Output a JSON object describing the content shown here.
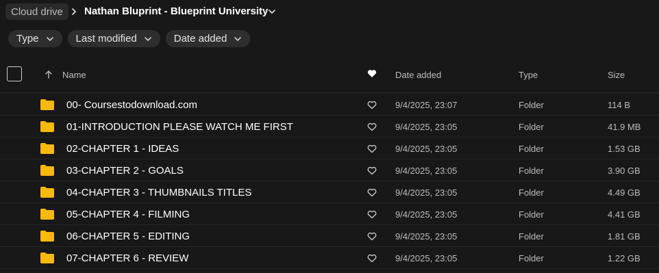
{
  "breadcrumb": {
    "root": "Cloud drive",
    "current": "Nathan Bluprint - Blueprint University"
  },
  "filters": [
    {
      "label": "Type"
    },
    {
      "label": "Last modified"
    },
    {
      "label": "Date added"
    }
  ],
  "columns": {
    "name": "Name",
    "date_added": "Date added",
    "type": "Type",
    "size": "Size"
  },
  "colors": {
    "background": "#181818",
    "folder": "#f5b90f",
    "chip": "#2e2e2e"
  },
  "rows": [
    {
      "name": "00- Coursestodownload.com",
      "date_added": "9/4/2025, 23:07",
      "type": "Folder",
      "size": "114 B"
    },
    {
      "name": "01-INTRODUCTION PLEASE WATCH ME FIRST",
      "date_added": "9/4/2025, 23:05",
      "type": "Folder",
      "size": "41.9 MB"
    },
    {
      "name": "02-CHAPTER 1 - IDEAS",
      "date_added": "9/4/2025, 23:05",
      "type": "Folder",
      "size": "1.53 GB"
    },
    {
      "name": "03-CHAPTER 2 - GOALS",
      "date_added": "9/4/2025, 23:05",
      "type": "Folder",
      "size": "3.90 GB"
    },
    {
      "name": "04-CHAPTER 3 - THUMBNAILS TITLES",
      "date_added": "9/4/2025, 23:05",
      "type": "Folder",
      "size": "4.49 GB"
    },
    {
      "name": "05-CHAPTER 4 - FILMING",
      "date_added": "9/4/2025, 23:05",
      "type": "Folder",
      "size": "4.41 GB"
    },
    {
      "name": "06-CHAPTER 5 - EDITING",
      "date_added": "9/4/2025, 23:05",
      "type": "Folder",
      "size": "1.81 GB"
    },
    {
      "name": "07-CHAPTER 6 - REVIEW",
      "date_added": "9/4/2025, 23:05",
      "type": "Folder",
      "size": "1.22 GB"
    }
  ]
}
